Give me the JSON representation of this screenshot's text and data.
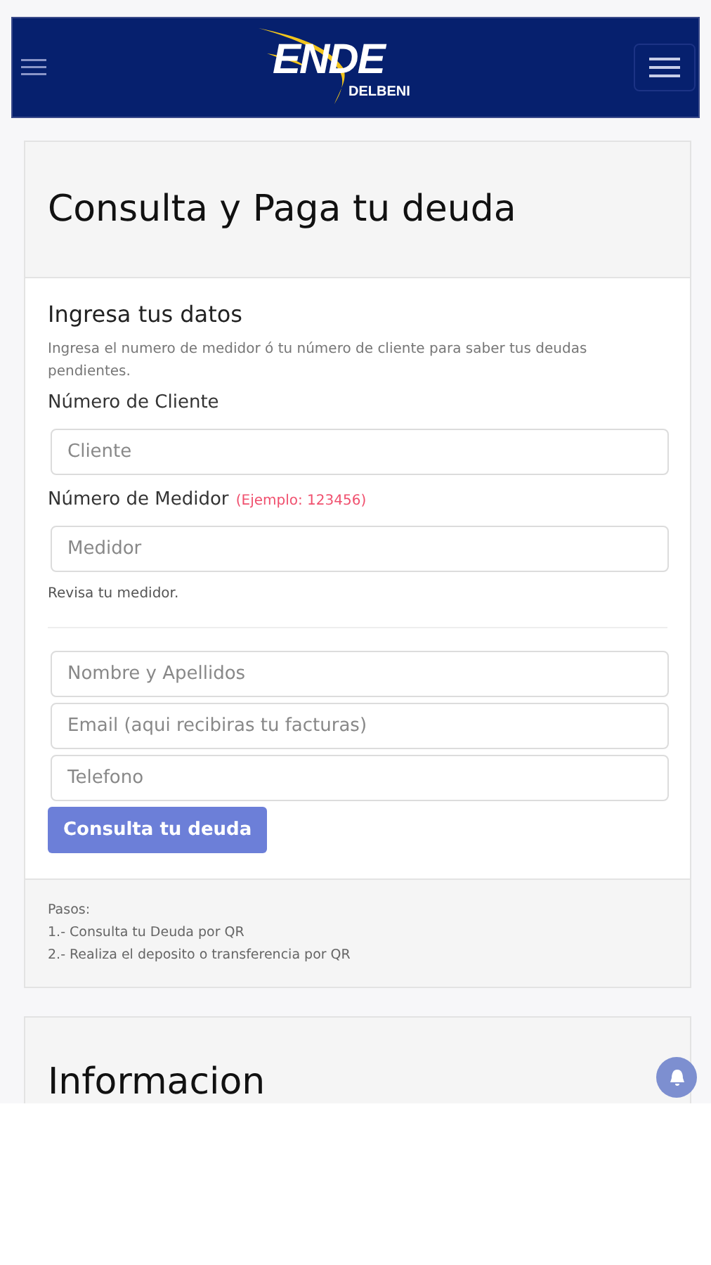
{
  "navbar": {
    "logo": {
      "title": "ENDE",
      "subtitle": "DELBENI"
    }
  },
  "card": {
    "title": "Consulta y Paga tu deuda",
    "subtitle": "Ingresa tus datos",
    "intro": "Ingresa el numero de medidor ó tu número de cliente para saber tus deudas pendientes.",
    "fields": [
      {
        "kind": "labeled",
        "label": "Número de Cliente",
        "placeholder": "Cliente"
      },
      {
        "kind": "labeled",
        "label": "Número de Medidor",
        "hint": "(Ejemplo: 123456)",
        "placeholder": "Medidor",
        "help": "Revisa tu medidor."
      },
      {
        "kind": "divider"
      },
      {
        "kind": "plain",
        "placeholder": "Nombre y Apellidos"
      },
      {
        "kind": "plain",
        "placeholder": "Email (aqui recibiras tu facturas)"
      },
      {
        "kind": "plain",
        "placeholder": "Telefono"
      }
    ],
    "button": "Consulta tu deuda",
    "footer": [
      "Pasos:",
      "1.- Consulta tu Deuda por QR",
      "2.- Realiza el deposito o transferencia por QR"
    ]
  },
  "info_card": {
    "title": "Informacion"
  }
}
